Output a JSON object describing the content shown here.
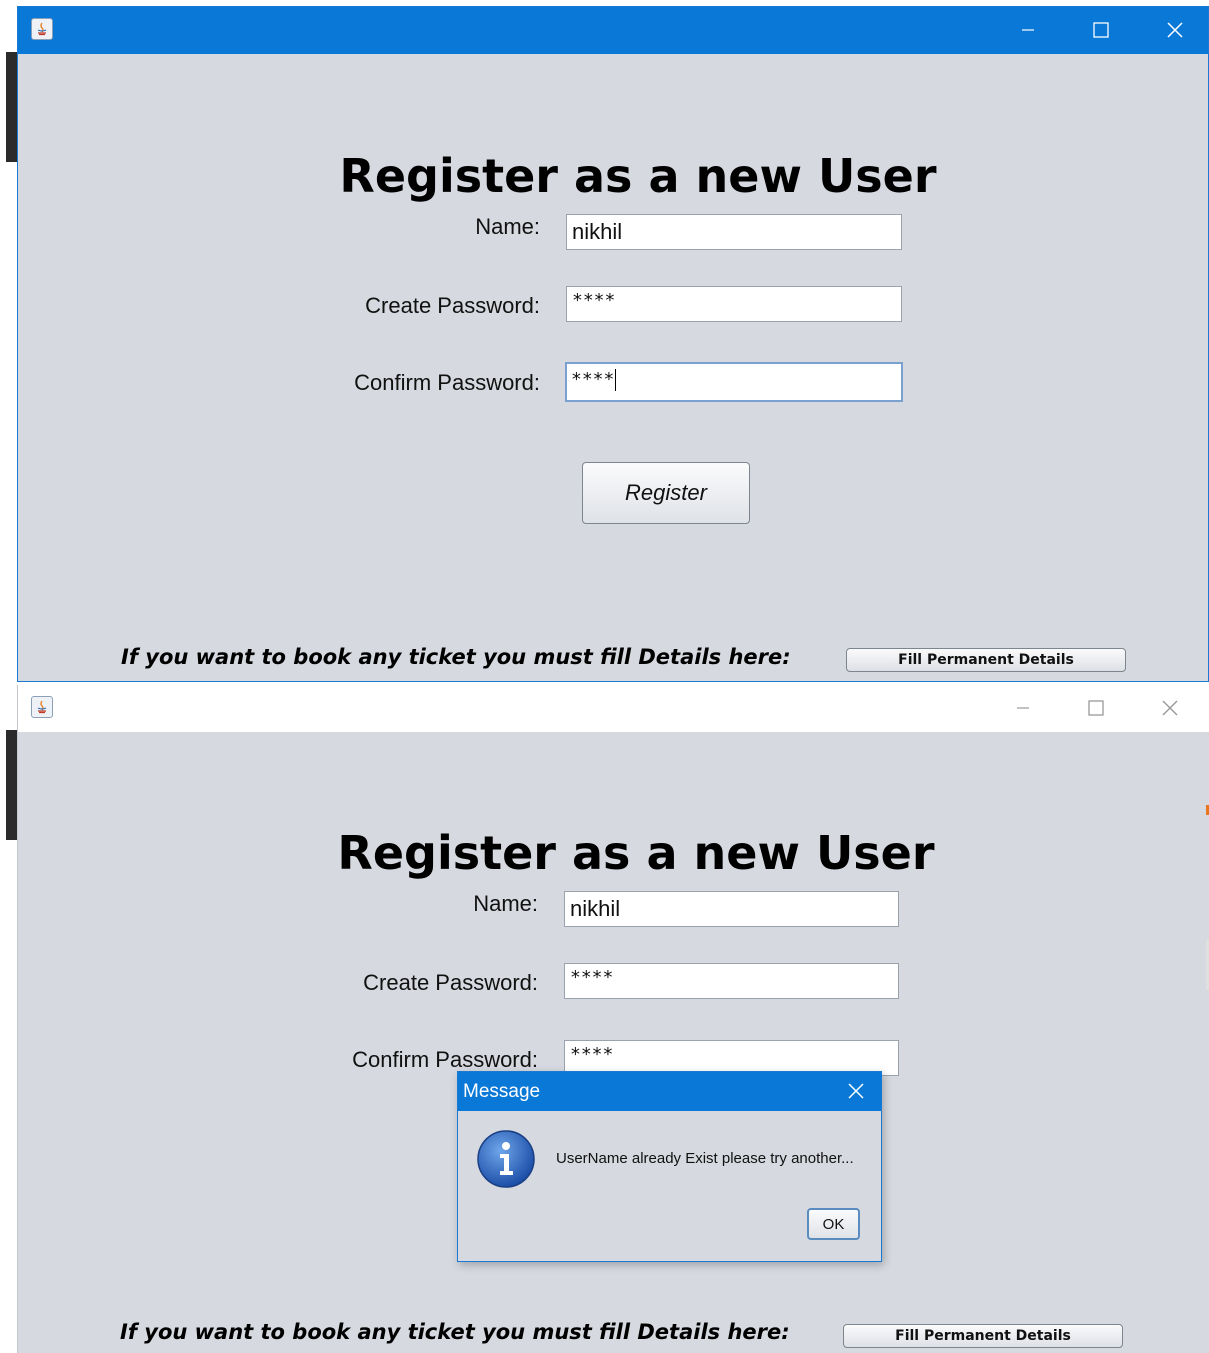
{
  "window_top": {
    "heading": "Register as a new User",
    "name_label": "Name:",
    "name_value": "nikhil",
    "create_password_label": "Create Password:",
    "create_password_value": "****",
    "confirm_password_label": "Confirm Password:",
    "confirm_password_value": "****",
    "register_label": "Register",
    "footer_text": "If you want to book any ticket you must fill Details here:",
    "fill_details_label": "Fill Permanent Details"
  },
  "window_bottom": {
    "heading": "Register as a new User",
    "name_label": "Name:",
    "name_value": "nikhil",
    "create_password_label": "Create Password:",
    "create_password_value": "****",
    "confirm_password_label": "Confirm Password:",
    "confirm_password_value": "****",
    "footer_text": "If you want to book any ticket you must fill Details here:",
    "fill_details_label": "Fill Permanent Details"
  },
  "dialog": {
    "title": "Message",
    "message": "UserName already Exist please try another...",
    "ok_label": "OK",
    "icon": "info-icon"
  },
  "colors": {
    "titlebar_active": "#0a78d7",
    "window_background": "#d6d9df"
  }
}
